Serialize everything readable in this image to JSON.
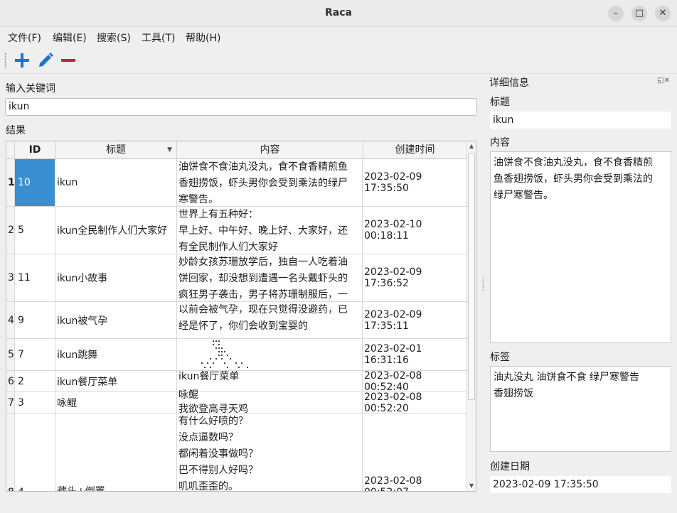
{
  "window": {
    "title": "Raca",
    "controls": [
      "–",
      "□",
      "✕"
    ]
  },
  "menu": [
    "文件(F)",
    "编辑(E)",
    "搜索(S)",
    "工具(T)",
    "帮助(H)"
  ],
  "toolbar": {
    "add_icon": "plus-icon",
    "edit_icon": "pencil-icon",
    "remove_icon": "minus-icon",
    "add_color": "#1a73d0",
    "remove_color": "#d0202a"
  },
  "search": {
    "label": "输入关键词",
    "value": "ikun"
  },
  "results": {
    "label": "结果",
    "columns": [
      "ID",
      "标题",
      "内容",
      "创建时间"
    ],
    "rows": [
      {
        "num": "1",
        "id": "10",
        "title": "ikun",
        "content": [
          "油饼食不食油丸没丸，食不食香精煎鱼",
          "香翅捞饭，虾头男你会受到乘法的绿尸",
          "寒警告。"
        ],
        "time": "2023-02-09 17:35:50"
      },
      {
        "num": "2",
        "id": "5",
        "title": "ikun全民制作人们大家好",
        "content": [
          "世界上有五种好：",
          "早上好、中午好、晚上好、大家好，还",
          "有全民制作人们大家好"
        ],
        "time": "2023-02-10 00:18:11"
      },
      {
        "num": "3",
        "id": "11",
        "title": "ikun小故事",
        "content": [
          "妙龄女孩苏珊放学后，独自一人吃着油",
          "饼回家，却没想到遭遇一名头戴虾头的",
          "疯狂男子袭击，男子将苏珊制服后，一"
        ],
        "time": "2023-02-09 17:36:52"
      },
      {
        "num": "4",
        "id": "9",
        "title": "ikun被气孕",
        "content": [
          "以前会被气孕，现在只觉得没避药，已",
          "经是怀了，你们会收到宝婴的"
        ],
        "time": "2023-02-09 17:35:11"
      },
      {
        "num": "5",
        "id": "7",
        "title": "ikun跳舞",
        "content": [
          ""
        ],
        "time": "2023-02-01 16:31:16"
      },
      {
        "num": "6",
        "id": "2",
        "title": "ikun餐厅菜单",
        "content": [
          "ikun餐厅菜单"
        ],
        "time": "2023-02-08 00:52:40"
      },
      {
        "num": "7",
        "id": "3",
        "title": "咏鲲",
        "content": [
          "咏鲲",
          "我欲登高寻天鸡"
        ],
        "time": "2023-02-08 00:52:20"
      },
      {
        "num": "8",
        "id": "4",
        "title": "藏头+倒置",
        "content": [
          "有什么好喷的？",
          "没点逼数吗？",
          "都闲着没事做吗？",
          "巴不得别人好吗？",
          "叽叽歪歪的。"
        ],
        "time": "2023-02-08 00:52:07"
      }
    ]
  },
  "details": {
    "dock_title": "详细信息",
    "dock_buttons": "◱✕",
    "title_label": "标题",
    "title_value": "ikun",
    "content_label": "内容",
    "content_lines": [
      "油饼食不食油丸没丸，食不食香精煎",
      "鱼香翅捞饭，虾头男你会受到乘法的",
      "绿尸寒警告。"
    ],
    "tags_label": "标签",
    "tags_lines": [
      "油丸没丸 油饼食不食 绿尸寒警告",
      "香翅捞饭"
    ],
    "date_label": "创建日期",
    "date_value": "2023-02-09 17:35:50"
  },
  "colors": {
    "selection": "#3a8fd0",
    "window_bg": "#efefef"
  }
}
